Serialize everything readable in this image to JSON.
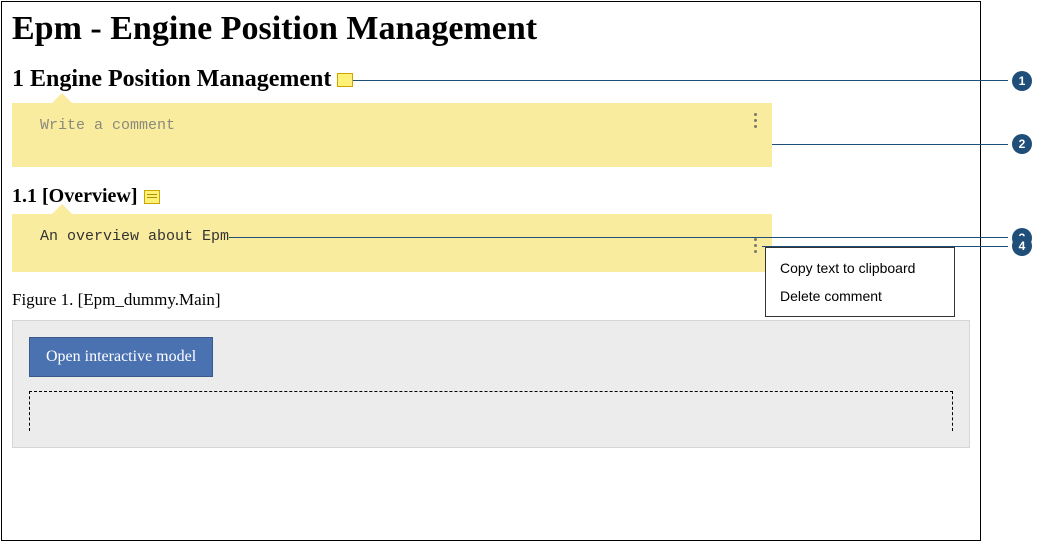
{
  "document": {
    "title": "Epm - Engine Position Management",
    "section1": {
      "number": "1",
      "heading": "Engine Position Management",
      "comment": {
        "placeholder": "Write a comment",
        "value": ""
      }
    },
    "section1_1": {
      "number": "1.1",
      "heading": "[Overview]",
      "comment": {
        "value": "An overview about Epm"
      }
    },
    "figure": {
      "label": "Figure 1. [Epm_dummy.Main]"
    },
    "open_button": "Open interactive model"
  },
  "context_menu": {
    "items": [
      "Copy text to clipboard",
      "Delete comment"
    ]
  },
  "callouts": [
    "1",
    "2",
    "3",
    "4"
  ]
}
